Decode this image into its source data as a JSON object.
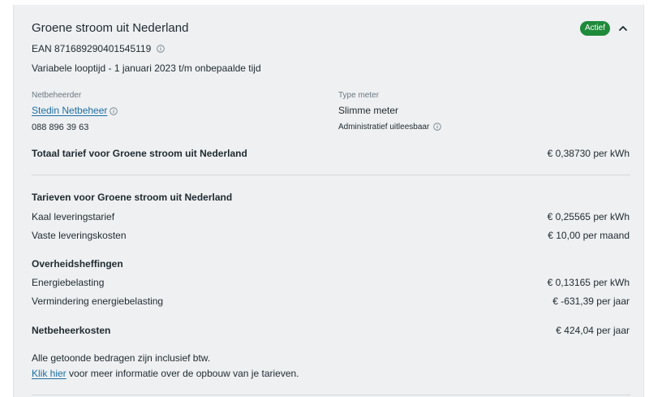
{
  "product": {
    "title": "Groene stroom uit Nederland",
    "status_badge": "Actief",
    "ean": "EAN 871689290401545119",
    "term": "Variabele looptijd - 1 januari 2023 t/m onbepaalde tijd"
  },
  "netbeheerder": {
    "label": "Netbeheerder",
    "name": "Stedin Netbeheer",
    "phone": "088 896 39 63"
  },
  "meter": {
    "label": "Type meter",
    "type": "Slimme meter",
    "reading": "Administratief uitleesbaar"
  },
  "total": {
    "label": "Totaal tarief voor Groene stroom uit Nederland",
    "value": "€ 0,38730 per kWh"
  },
  "tariffs": {
    "heading": "Tarieven voor Groene stroom uit Nederland",
    "rows": [
      {
        "label": "Kaal leveringstarief",
        "value": "€ 0,25565 per kWh"
      },
      {
        "label": "Vaste leveringskosten",
        "value": "€ 10,00 per maand"
      }
    ]
  },
  "levies": {
    "heading": "Overheidsheffingen",
    "rows": [
      {
        "label": "Energiebelasting",
        "value": "€ 0,13165 per kWh"
      },
      {
        "label": "Vermindering energiebelasting",
        "value": "€ -631,39 per jaar"
      }
    ]
  },
  "network_costs": {
    "label": "Netbeheerkosten",
    "value": "€ 424,04 per jaar"
  },
  "footer": {
    "note": "Alle getoonde bedragen zijn inclusief btw.",
    "link": "Klik hier",
    "link_suffix": " voor meer informatie over de opbouw van je tarieven."
  },
  "icons": {
    "info": "info-circle-icon",
    "chevron": "chevron-up-icon"
  },
  "colors": {
    "badge": "#1f8a3a",
    "link": "#1d6fa3",
    "card_bg": "#eef0f2"
  }
}
